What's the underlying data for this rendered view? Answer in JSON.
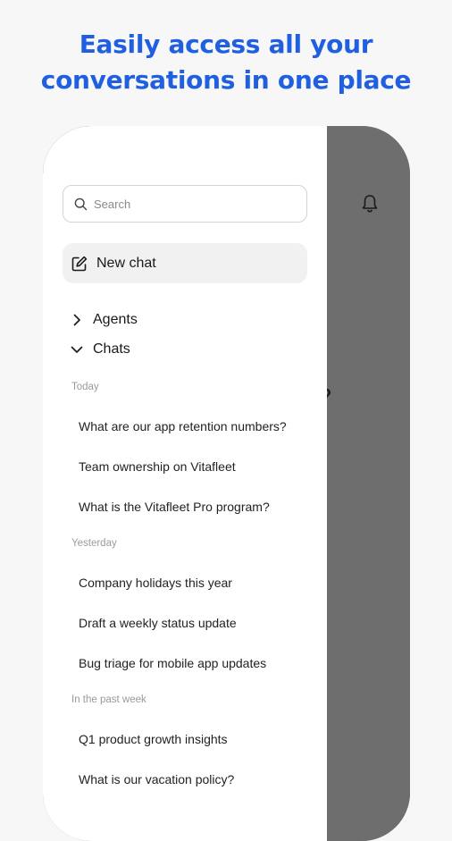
{
  "headline": {
    "line1": "Easily access all your",
    "line2": "conversations in one place"
  },
  "search": {
    "placeholder": "Search"
  },
  "new_chat": {
    "label": "New chat"
  },
  "sections": {
    "agents": "Agents",
    "chats": "Chats"
  },
  "groups": {
    "today": {
      "label": "Today",
      "items": [
        "What are our app retention numbers?",
        "Team ownership on Vitafleet",
        "What is the Vitafleet Pro program?"
      ]
    },
    "yesterday": {
      "label": "Yesterday",
      "items": [
        "Company holidays this year",
        "Draft a weekly status update",
        "Bug triage for mobile app updates"
      ]
    },
    "past_week": {
      "label": "In the past week",
      "items": [
        "Q1 product growth insights",
        "What is our vacation policy?"
      ]
    }
  },
  "background": {
    "peek_text": "?"
  },
  "colors": {
    "accent": "#1f5fe0",
    "overlay": "#6e6e6e",
    "drawer": "#ffffff"
  },
  "icons": [
    "search-icon",
    "edit-icon",
    "chevron-right-icon",
    "chevron-down-icon",
    "bell-icon"
  ]
}
